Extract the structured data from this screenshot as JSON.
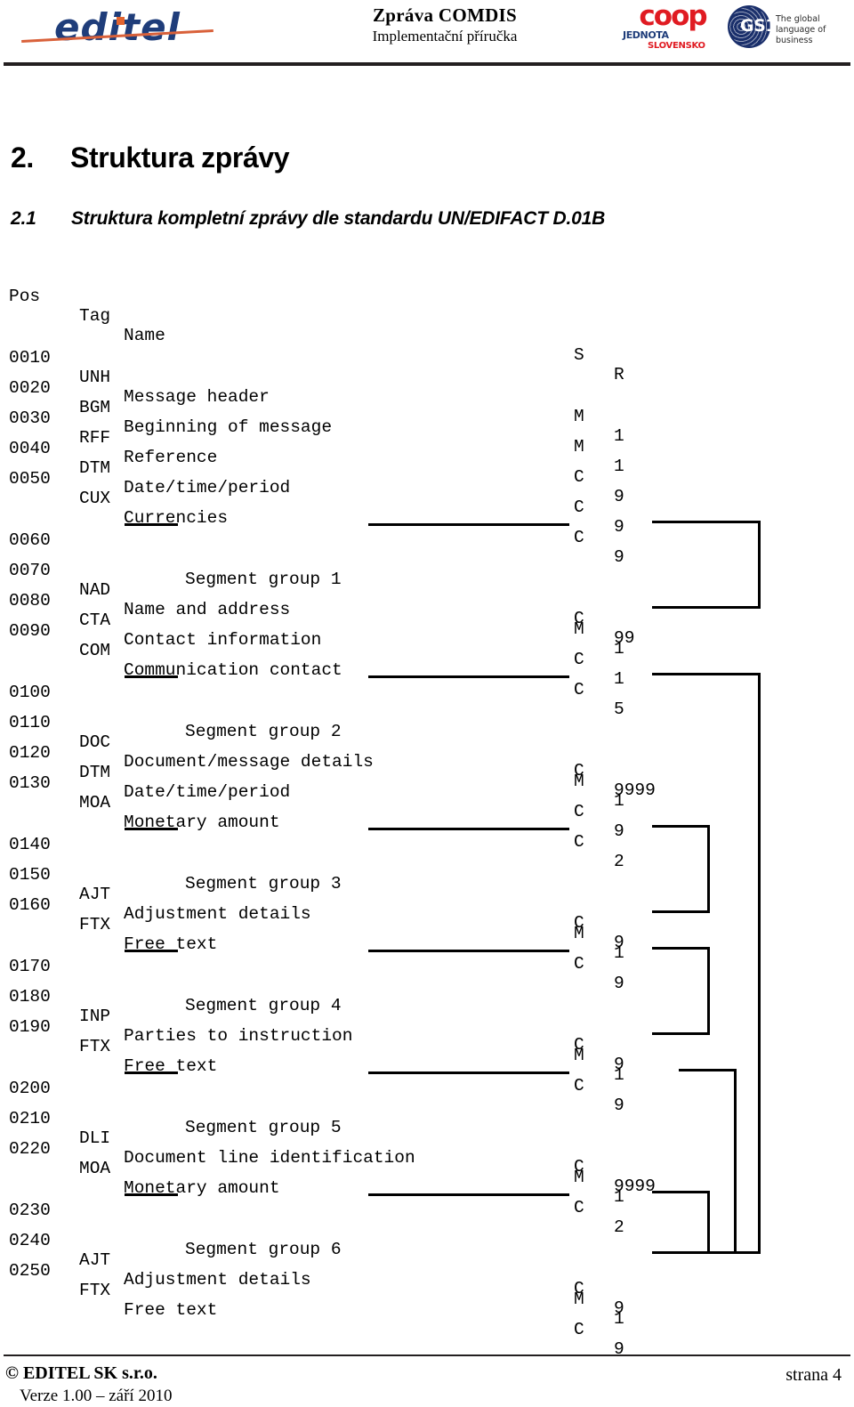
{
  "header": {
    "editel_logo_text": "editel",
    "doc_title": "Zpráva COMDIS",
    "doc_subtitle": "Implementační příručka",
    "coop_text": "coop",
    "coop_jednota": "JEDNOTA",
    "coop_slovensko": "SLOVENSKO",
    "gs1_text": "GS1",
    "gs1_tagline": "The global language of business"
  },
  "headings": {
    "h1_number": "2.",
    "h1_text": "Struktura zprávy",
    "h2_number": "2.1",
    "h2_text": "Struktura kompletní zprávy dle standardu UN/EDIFACT D.01B"
  },
  "table": {
    "columns": {
      "pos": "Pos",
      "tag": "Tag",
      "name": "Name",
      "s": "S",
      "r": "R"
    },
    "rows": [
      {
        "pos": "0010",
        "tag": "UNH",
        "name": "Message header",
        "s": "M",
        "r": "1"
      },
      {
        "pos": "0020",
        "tag": "BGM",
        "name": "Beginning of message",
        "s": "M",
        "r": "1"
      },
      {
        "pos": "0030",
        "tag": "RFF",
        "name": "Reference",
        "s": "C",
        "r": "9"
      },
      {
        "pos": "0040",
        "tag": "DTM",
        "name": "Date/time/period",
        "s": "C",
        "r": "9"
      },
      {
        "pos": "0050",
        "tag": "CUX",
        "name": "Currencies",
        "s": "C",
        "r": "9"
      },
      {
        "pos": "0060",
        "group": "Segment group 1",
        "s": "C",
        "r": "99"
      },
      {
        "pos": "0070",
        "tag": "NAD",
        "name": "Name and address",
        "s": "M",
        "r": "1"
      },
      {
        "pos": "0080",
        "tag": "CTA",
        "name": "Contact information",
        "s": "C",
        "r": "1"
      },
      {
        "pos": "0090",
        "tag": "COM",
        "name": "Communication contact",
        "s": "C",
        "r": "5"
      },
      {
        "pos": "0100",
        "group": "Segment group 2",
        "s": "C",
        "r": "9999"
      },
      {
        "pos": "0110",
        "tag": "DOC",
        "name": "Document/message details",
        "s": "M",
        "r": "1"
      },
      {
        "pos": "0120",
        "tag": "DTM",
        "name": "Date/time/period",
        "s": "C",
        "r": "9"
      },
      {
        "pos": "0130",
        "tag": "MOA",
        "name": "Monetary amount",
        "s": "C",
        "r": "2"
      },
      {
        "pos": "0140",
        "group": "Segment group 3",
        "s": "C",
        "r": "9"
      },
      {
        "pos": "0150",
        "tag": "AJT",
        "name": "Adjustment details",
        "s": "M",
        "r": "1"
      },
      {
        "pos": "0160",
        "tag": "FTX",
        "name": "Free text",
        "s": "C",
        "r": "9"
      },
      {
        "pos": "0170",
        "group": "Segment group 4",
        "s": "C",
        "r": "9"
      },
      {
        "pos": "0180",
        "tag": "INP",
        "name": "Parties to instruction",
        "s": "M",
        "r": "1"
      },
      {
        "pos": "0190",
        "tag": "FTX",
        "name": "Free text",
        "s": "C",
        "r": "9"
      },
      {
        "pos": "0200",
        "group": "Segment group 5",
        "s": "C",
        "r": "9999"
      },
      {
        "pos": "0210",
        "tag": "DLI",
        "name": "Document line identification",
        "s": "M",
        "r": "1"
      },
      {
        "pos": "0220",
        "tag": "MOA",
        "name": "Monetary amount",
        "s": "C",
        "r": "2"
      },
      {
        "pos": "0230",
        "group": "Segment group 6",
        "s": "C",
        "r": "9"
      },
      {
        "pos": "0240",
        "tag": "AJT",
        "name": "Adjustment details",
        "s": "M",
        "r": "1"
      },
      {
        "pos": "0250",
        "tag": "FTX",
        "name": "Free text",
        "s": "C",
        "r": "9"
      }
    ]
  },
  "footer": {
    "copyright": "© EDITEL SK s.r.o.",
    "version": "Verze 1.00 – září 2010",
    "page": "strana 4"
  }
}
